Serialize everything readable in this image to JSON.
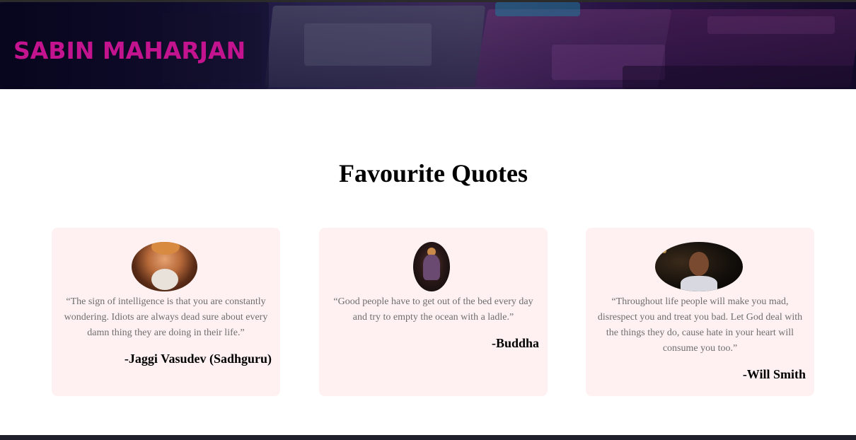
{
  "header": {
    "site_title": "SABIN MAHARJAN"
  },
  "quotes_section": {
    "title": "Favourite Quotes",
    "cards": [
      {
        "quote": "“The sign of intelligence is that you are constantly wondering. Idiots are always dead sure about every damn thing they are doing in their life.”",
        "author": "-Jaggi Vasudev (Sadhguru)"
      },
      {
        "quote": "“Good people have to get out of the bed every day and try to empty the ocean with a ladle.”",
        "author": "-Buddha"
      },
      {
        "quote": "“Throughout life people will make you mad, disrespect you and treat you bad. Let God deal with the things they do, cause hate in your heart will consume you too.”",
        "author": "-Will Smith"
      }
    ]
  },
  "colors": {
    "title_accent": "#c4138f",
    "card_background": "#fff1f1",
    "quote_text": "#6e6e6e"
  }
}
